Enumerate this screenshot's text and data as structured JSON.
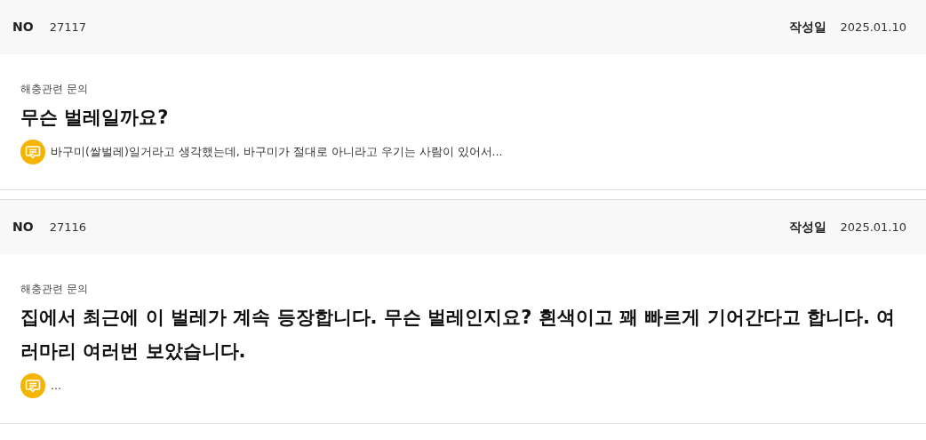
{
  "posts": [
    {
      "no_label": "NO",
      "no": "27117",
      "date_label": "작성일",
      "date": "2025.01.10",
      "category": "해충관련 문의",
      "title": "무슨 벌레일까요?",
      "answer": "바구미(쌀벌레)일거라고 생각했는데, 바구미가 절대로 아니라고 우기는 사람이 있어서..."
    },
    {
      "no_label": "NO",
      "no": "27116",
      "date_label": "작성일",
      "date": "2025.01.10",
      "category": "해충관련 문의",
      "title": "집에서 최근에 이 벌레가 계속 등장합니다. 무슨 벌레인지요? 흰색이고 꽤 빠르게 기어간다고 합니다. 여러마리 여러번 보았습니다.",
      "answer": "..."
    }
  ]
}
